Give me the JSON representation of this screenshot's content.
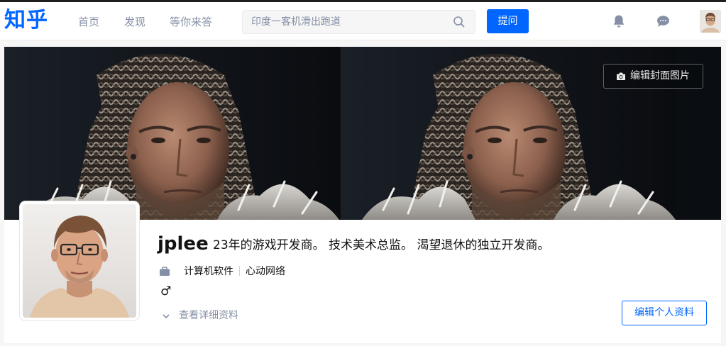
{
  "header": {
    "logo": "知乎",
    "nav": [
      "首页",
      "发现",
      "等你来答"
    ],
    "search_placeholder": "印度一客机滑出跑道",
    "ask_label": "提问"
  },
  "cover": {
    "edit_label": "编辑封面图片"
  },
  "profile": {
    "name": "jplee",
    "headline": "23年的游戏开发商。 技术美术总监。 渴望退休的独立开发商。",
    "industry": "计算机软件",
    "company": "心动网络",
    "gender_symbol": "♂",
    "details_label": "查看详细资料",
    "edit_profile_label": "编辑个人资料"
  },
  "colors": {
    "brand": "#0066ff",
    "muted": "#8590a6"
  }
}
